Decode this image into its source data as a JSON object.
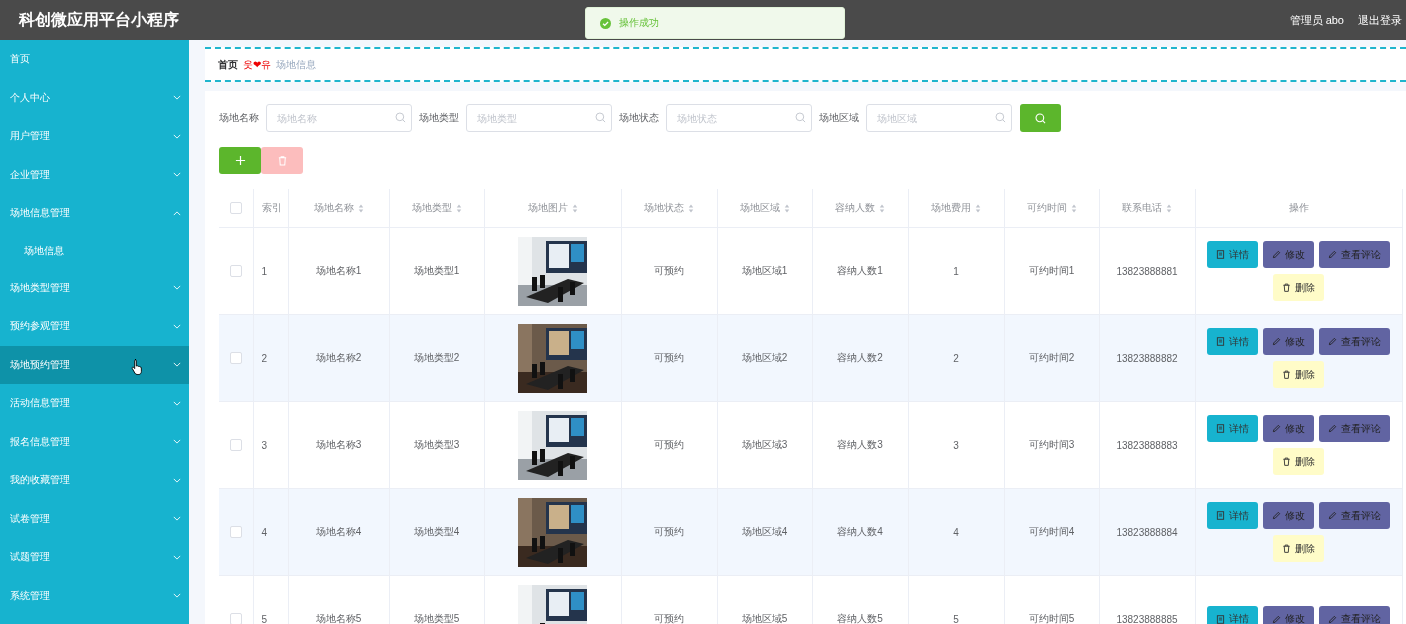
{
  "header": {
    "title": "科创微应用平台小程序",
    "user": "管理员 abo",
    "logout": "退出登录"
  },
  "toast": {
    "kind": "success",
    "message": "操作成功"
  },
  "sidebar": {
    "items": [
      {
        "label": "首页",
        "kind": "link",
        "hovered": false
      },
      {
        "label": "个人中心",
        "kind": "submenu",
        "expanded": false,
        "hovered": false
      },
      {
        "label": "用户管理",
        "kind": "submenu",
        "expanded": false,
        "hovered": false
      },
      {
        "label": "企业管理",
        "kind": "submenu",
        "expanded": false,
        "hovered": false
      },
      {
        "label": "场地信息管理",
        "kind": "submenu",
        "expanded": true,
        "hovered": false,
        "children": [
          {
            "label": "场地信息"
          }
        ]
      },
      {
        "label": "场地类型管理",
        "kind": "submenu",
        "expanded": false,
        "hovered": false
      },
      {
        "label": "预约参观管理",
        "kind": "submenu",
        "expanded": false,
        "hovered": false
      },
      {
        "label": "场地预约管理",
        "kind": "submenu",
        "expanded": false,
        "hovered": true
      },
      {
        "label": "活动信息管理",
        "kind": "submenu",
        "expanded": false,
        "hovered": false
      },
      {
        "label": "报名信息管理",
        "kind": "submenu",
        "expanded": false,
        "hovered": false
      },
      {
        "label": "我的收藏管理",
        "kind": "submenu",
        "expanded": false,
        "hovered": false
      },
      {
        "label": "试卷管理",
        "kind": "submenu",
        "expanded": false,
        "hovered": false
      },
      {
        "label": "试题管理",
        "kind": "submenu",
        "expanded": false,
        "hovered": false
      },
      {
        "label": "系统管理",
        "kind": "submenu",
        "expanded": false,
        "hovered": false
      }
    ]
  },
  "breadcrumb": {
    "home": "首页",
    "separator": "웃❤유",
    "current": "场地信息"
  },
  "search": {
    "fields": [
      {
        "label": "场地名称",
        "placeholder": "场地名称"
      },
      {
        "label": "场地类型",
        "placeholder": "场地类型"
      },
      {
        "label": "场地状态",
        "placeholder": "场地状态"
      },
      {
        "label": "场地区域",
        "placeholder": "场地区域"
      }
    ]
  },
  "toolbar": {
    "add": {
      "disabled": false
    },
    "delete": {
      "disabled": true
    }
  },
  "table": {
    "all_checked": false,
    "columns": [
      {
        "label": "索引",
        "sortable": false
      },
      {
        "label": "场地名称",
        "sortable": true
      },
      {
        "label": "场地类型",
        "sortable": true
      },
      {
        "label": "场地图片",
        "sortable": true
      },
      {
        "label": "场地状态",
        "sortable": true
      },
      {
        "label": "场地区域",
        "sortable": true
      },
      {
        "label": "容纳人数",
        "sortable": true
      },
      {
        "label": "场地费用",
        "sortable": true
      },
      {
        "label": "可约时间",
        "sortable": true
      },
      {
        "label": "联系电话",
        "sortable": true
      },
      {
        "label": "操作",
        "sortable": false
      }
    ],
    "rows": [
      {
        "checked": false,
        "cells": [
          "1",
          "场地名称1",
          "场地类型1",
          {
            "kind": "picture"
          },
          "可预约",
          "场地区域1",
          "容纳人数1",
          "1",
          "可约时间1",
          "13823888881"
        ],
        "actions": [
          {
            "kind": "detail",
            "label": "详情"
          },
          {
            "kind": "edit",
            "label": "修改"
          },
          {
            "kind": "comment",
            "label": "查看评论"
          },
          {
            "kind": "delete",
            "label": "删除"
          }
        ]
      },
      {
        "checked": false,
        "cells": [
          "2",
          "场地名称2",
          "场地类型2",
          {
            "kind": "picture"
          },
          "可预约",
          "场地区域2",
          "容纳人数2",
          "2",
          "可约时间2",
          "13823888882"
        ],
        "actions": [
          {
            "kind": "detail",
            "label": "详情"
          },
          {
            "kind": "edit",
            "label": "修改"
          },
          {
            "kind": "comment",
            "label": "查看评论"
          },
          {
            "kind": "delete",
            "label": "删除"
          }
        ]
      },
      {
        "checked": false,
        "cells": [
          "3",
          "场地名称3",
          "场地类型3",
          {
            "kind": "picture"
          },
          "可预约",
          "场地区域3",
          "容纳人数3",
          "3",
          "可约时间3",
          "13823888883"
        ],
        "actions": [
          {
            "kind": "detail",
            "label": "详情"
          },
          {
            "kind": "edit",
            "label": "修改"
          },
          {
            "kind": "comment",
            "label": "查看评论"
          },
          {
            "kind": "delete",
            "label": "删除"
          }
        ]
      },
      {
        "checked": false,
        "cells": [
          "4",
          "场地名称4",
          "场地类型4",
          {
            "kind": "picture"
          },
          "可预约",
          "场地区域4",
          "容纳人数4",
          "4",
          "可约时间4",
          "13823888884"
        ],
        "actions": [
          {
            "kind": "detail",
            "label": "详情"
          },
          {
            "kind": "edit",
            "label": "修改"
          },
          {
            "kind": "comment",
            "label": "查看评论"
          },
          {
            "kind": "delete",
            "label": "删除"
          }
        ]
      },
      {
        "checked": false,
        "cells": [
          "5",
          "场地名称5",
          "场地类型5",
          {
            "kind": "picture"
          },
          "可预约",
          "场地区域5",
          "容纳人数5",
          "5",
          "可约时间5",
          "13823888885"
        ],
        "actions": [
          {
            "kind": "detail",
            "label": "详情"
          },
          {
            "kind": "edit",
            "label": "修改"
          },
          {
            "kind": "comment",
            "label": "查看评论"
          }
        ]
      }
    ]
  }
}
